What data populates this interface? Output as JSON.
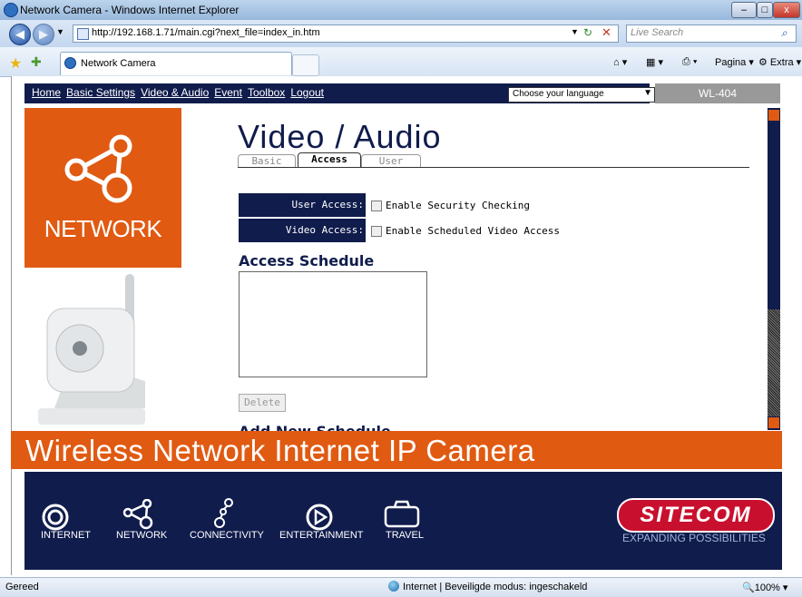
{
  "browser": {
    "window_title": "Network Camera - Windows Internet Explorer",
    "url": "http://192.168.1.71/main.cgi?next_file=index_in.htm",
    "search_placeholder": "Live Search",
    "tab_title": "Network Camera",
    "commands": {
      "page": "Pagina",
      "extra": "Extra"
    },
    "status_left": "Gereed",
    "status_zone": "Internet | Beveiligde modus: ingeschakeld",
    "zoom": "100%"
  },
  "nav": {
    "links": [
      "Home",
      "Basic Settings",
      "Video & Audio",
      "Event",
      "Toolbox",
      "Logout"
    ],
    "language_select": "Choose your language",
    "model": "WL-404"
  },
  "sidebar": {
    "network_label": "NETWORK"
  },
  "main": {
    "heading": "Video / Audio",
    "tabs": [
      "Basic",
      "Access",
      "User"
    ],
    "active_tab": "Access",
    "user_access_label": "User Access:",
    "user_access_option": "Enable Security Checking",
    "video_access_label": "Video Access:",
    "video_access_option": "Enable Scheduled Video Access",
    "schedule_title": "Access Schedule",
    "delete_label": "Delete",
    "add_new_title": "Add New Schedule"
  },
  "banner": {
    "text": "Wireless Network Internet IP Camera"
  },
  "footer": {
    "items": [
      "INTERNET",
      "NETWORK",
      "CONNECTIVITY",
      "ENTERTAINMENT",
      "TRAVEL"
    ],
    "brand": "SITECOM",
    "tagline": "EXPANDING POSSIBILITIES"
  },
  "colors": {
    "navy": "#101c4c",
    "orange": "#e05a12",
    "brand_red": "#c8102e"
  }
}
